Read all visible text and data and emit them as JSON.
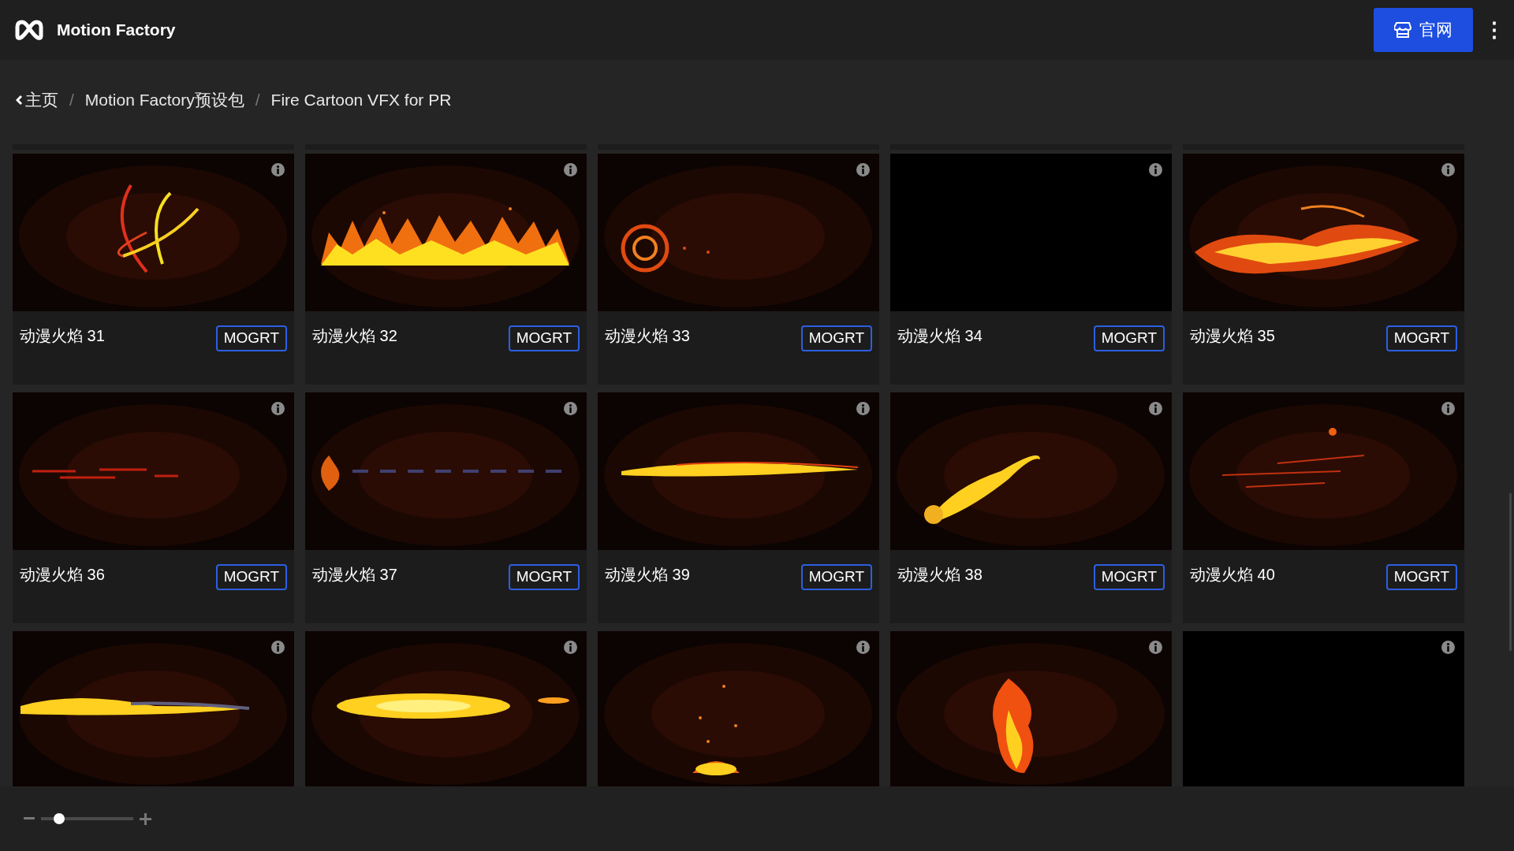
{
  "app": {
    "name": "Motion Factory"
  },
  "header": {
    "site_button": "官网",
    "more_icon": "⋮"
  },
  "breadcrumb": [
    {
      "label": "主页"
    },
    {
      "separator": "/",
      "label": "Motion Factory预设包"
    },
    {
      "separator": "/",
      "label": "Fire Cartoon VFX for PR"
    }
  ],
  "cards": [
    {
      "title": "动漫火焰 31",
      "tag": "MOGRT",
      "kind": "picture"
    },
    {
      "title": "动漫火焰 32",
      "tag": "MOGRT",
      "kind": "picture"
    },
    {
      "title": "动漫火焰 33",
      "tag": "MOGRT",
      "kind": "picture"
    },
    {
      "title": "动漫火焰 34",
      "tag": "MOGRT",
      "kind": "blank"
    },
    {
      "title": "动漫火焰 35",
      "tag": "MOGRT",
      "kind": "picture"
    },
    {
      "title": "动漫火焰 36",
      "tag": "MOGRT",
      "kind": "picture"
    },
    {
      "title": "动漫火焰 37",
      "tag": "MOGRT",
      "kind": "picture"
    },
    {
      "title": "动漫火焰 39",
      "tag": "MOGRT",
      "kind": "picture"
    },
    {
      "title": "动漫火焰 38",
      "tag": "MOGRT",
      "kind": "picture"
    },
    {
      "title": "动漫火焰 40",
      "tag": "MOGRT",
      "kind": "picture"
    },
    {
      "kind": "picture"
    },
    {
      "kind": "picture"
    },
    {
      "kind": "picture"
    },
    {
      "kind": "picture"
    },
    {
      "kind": "blank"
    }
  ],
  "zoom_slider": {
    "level": 0.2
  }
}
